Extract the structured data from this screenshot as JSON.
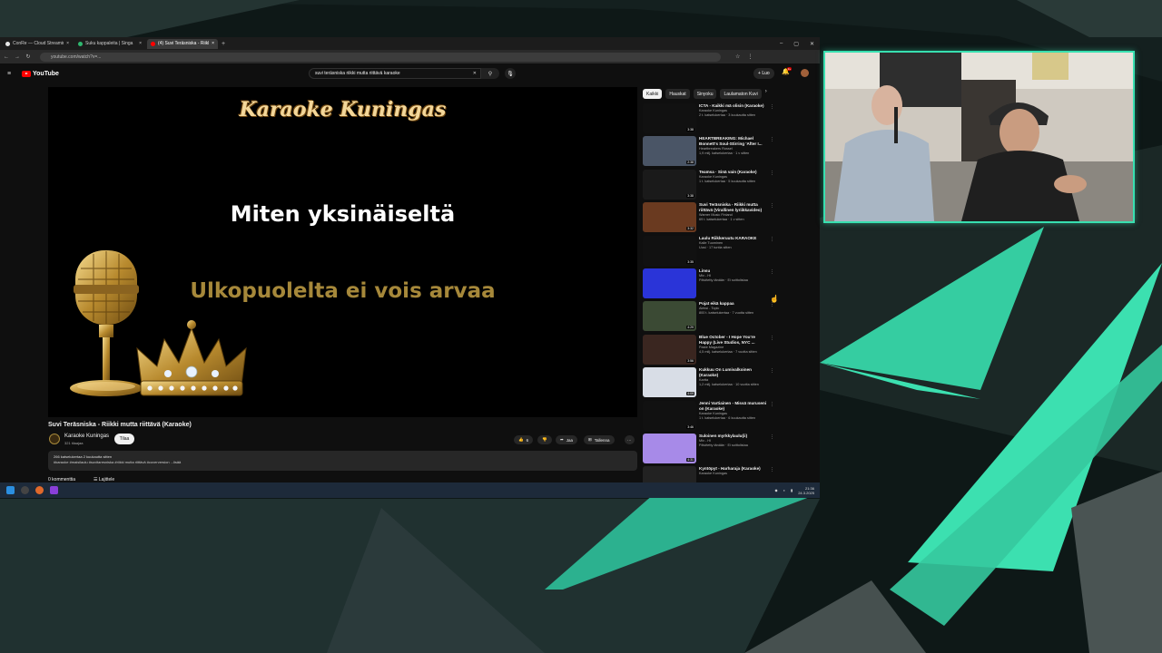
{
  "browser": {
    "tabs": [
      {
        "label": "ConRe — Cloud Streaming Bot",
        "active": false
      },
      {
        "label": "Suku kappaleita | Singa",
        "active": false
      },
      {
        "label": "(4) Suvi Teräsniska - Riikki m",
        "active": true
      }
    ],
    "url": "youtube.com/watch?v=..."
  },
  "youtube": {
    "logo_text": "YouTube",
    "search_query": "suvi teräsniska riikki mutta riittävä karaoke",
    "create_label": "Luo",
    "notification_count": "9+"
  },
  "player": {
    "brand": "Karaoke Kuningas",
    "lyric_current": "Miten yksinäiseltä",
    "lyric_next": "Ulkopuolelta ei vois arvaa"
  },
  "video": {
    "title": "Suvi Teräsniska - Riikki mutta riittävä (Karaoke)",
    "channel": "Karaoke Kuningas",
    "subscribers": "321 tilaajaa",
    "subscribe_label": "Tilaa",
    "like_count": "6",
    "share_label": "Jaa",
    "save_label": "Tallenna",
    "more_label": "···",
    "desc_line1": "266 katselukertaa  2 kuukautta sitten",
    "desc_line2": "#karaoke #maisilaulu #suvitaresniska #riikki mutta riittävä #coverversion ...lisää",
    "comments_label": "0 kommenttia",
    "sort_label": "Lajittele"
  },
  "sidebar": {
    "chips": [
      "Kaikki",
      "Hauskat",
      "Sinyoku",
      "Laulamaton Kuvi"
    ],
    "recs": [
      {
        "title": "ICTA - Kaikki mä olisin (Karaoke)",
        "channel": "Karaoke Kuningas",
        "stats": "2 t. katselukertaa · 3 kuukautta sitten",
        "duration": "3:38"
      },
      {
        "title": "HEARTBREAKING: Michael Bonnett's Soul-Stirring 'After I...",
        "channel": "Heartbreakers Rossel",
        "stats": "1,9 milj. katselukertaa · 1 v sitten",
        "duration": "2:38"
      },
      {
        "title": "Teamsa · Sinä vain (Karaoke)",
        "channel": "Karaoke Kuningas",
        "stats": "1 t. katselukertaa · 5 kuukautta sitten",
        "duration": "3:38"
      },
      {
        "title": "Suvi Teräsniska - Riikki mutta riittävä (Virallinen lyriikkavideo)",
        "channel": "Warner Music Finland",
        "stats": "69 t. katselukertaa · 1 v sitten",
        "duration": "3:32"
      },
      {
        "title": "Laulu Riikkeruutu KARAOKE",
        "channel": "Kalle Tuominen",
        "stats": "Uusi · 17 tuntia sitten",
        "duration": "3:35"
      },
      {
        "title": "Linsu",
        "channel": "Mix - HI",
        "stats": "Päivitetty tänään · Ei soittolistaa",
        "duration": ""
      },
      {
        "title": "Pojat eikä kappaa",
        "channel": "Aleksi - Topic",
        "stats": "800 t. katselukertaa · 7 vuotta sitten",
        "duration": "4:29"
      },
      {
        "title": "Blue October - I Hope You're Happy (Live Studios, NYC ...",
        "channel": "Paste Magazine",
        "stats": "4,5 milj. katselukertaa · 7 vuotta sitten",
        "duration": "3:56"
      },
      {
        "title": "Kukkuu On Lumivalkoinen (Karaoke)",
        "channel": "Kartta",
        "stats": "1,2 milj. katselukertaa · 10 vuotta sitten",
        "duration": "4:09"
      },
      {
        "title": "Jenni Vartiainen - Missä muruseni on (Karaoke)",
        "channel": "Karaoke Kuningas",
        "stats": "1 t. katselukertaa · 6 kuukautta sitten",
        "duration": "3:46"
      },
      {
        "title": "Suloinen myrkkylaulu(ii)",
        "channel": "Mix - HI",
        "stats": "Päivitetty tänään · Ei soittolistaa",
        "duration": "4:31"
      },
      {
        "title": "Kyntöpyt - Harharaja (Karaoke)",
        "channel": "Karaoke Kuningas",
        "stats": "",
        "duration": ""
      }
    ]
  },
  "taskbar": {
    "time": "21:36",
    "date": "24.3.2025"
  },
  "colors": {
    "accent_teal": "#38e0b0",
    "youtube_red": "#ff0000",
    "lyric_next_gold": "#a6883a"
  }
}
